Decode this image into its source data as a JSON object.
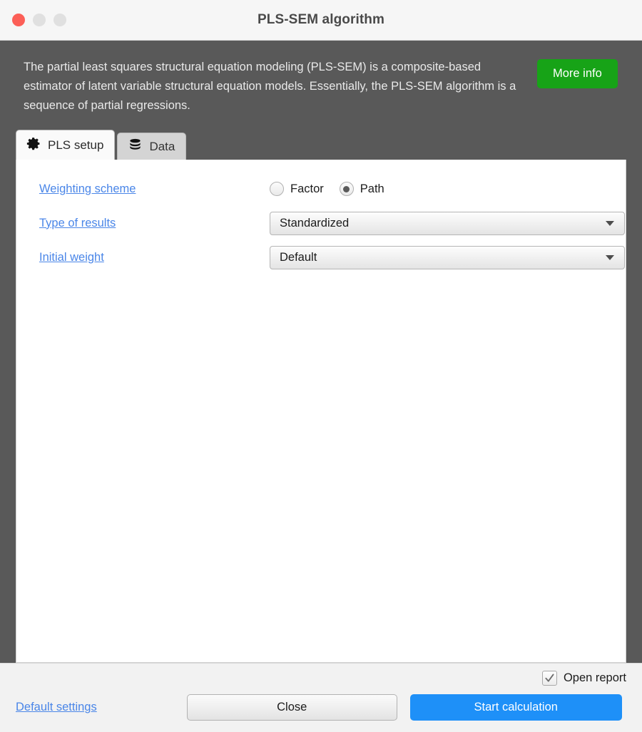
{
  "window": {
    "title": "PLS-SEM algorithm",
    "traffic_lights": [
      "close",
      "minimize",
      "maximize"
    ]
  },
  "description": {
    "text": "The partial least squares structural equation modeling (PLS-SEM) is a composite-based estimator of latent variable structural equation models. Essentially, the PLS-SEM algorithm is a sequence of partial regressions.",
    "more_info_label": "More info",
    "more_info_color": "#17a317",
    "band_color": "#595959"
  },
  "tabs": [
    {
      "label": "PLS setup",
      "icon": "gear-icon",
      "active": true
    },
    {
      "label": "Data",
      "icon": "database-icon",
      "active": false
    }
  ],
  "form": {
    "rows": [
      {
        "label": "Weighting scheme",
        "type": "radio",
        "options": [
          {
            "label": "Factor",
            "selected": false
          },
          {
            "label": "Path",
            "selected": true
          }
        ]
      },
      {
        "label": "Type of results",
        "type": "select",
        "value": "Standardized"
      },
      {
        "label": "Initial weight",
        "type": "select",
        "value": "Default"
      }
    ],
    "link_color": "#4a86e8"
  },
  "footer": {
    "open_report_label": "Open report",
    "open_report_checked": true,
    "default_settings_label": "Default settings",
    "close_label": "Close",
    "start_label": "Start calculation",
    "start_color": "#1e90f8"
  }
}
